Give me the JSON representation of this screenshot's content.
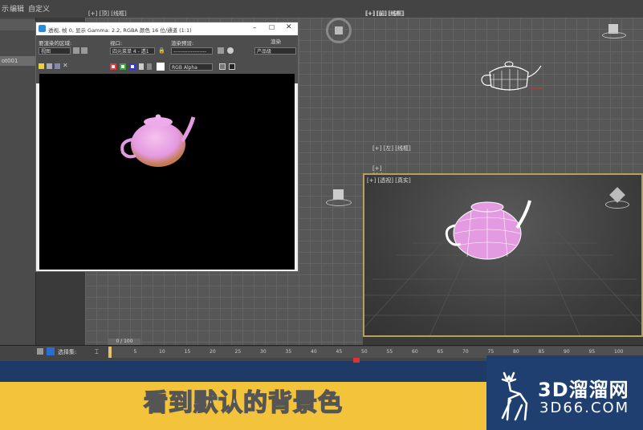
{
  "menu": {
    "item1": "示",
    "item2": "编辑",
    "item3": "自定义"
  },
  "left_panel": {
    "selected_item": "ot001"
  },
  "viewports": {
    "top_label": "[+] [顶] [线框]",
    "front_label": "[+] [前] [线框]",
    "left_label": "[+] [左] [线框]",
    "persp_label": "[+] [透视] [真实]"
  },
  "render_window": {
    "title": "透视, 帧 0, 显示 Gamma: 2.2, RGBA 颜色 16 位/通道 (1:1)",
    "area_label": "要渲染的区域:",
    "area_value": "视图",
    "viewport_label": "视口:",
    "viewport_value": "四元菜单 4 - 透1",
    "preset_label": "渲染预设:",
    "preset_value": "-------------------",
    "render_button": "渲染",
    "product_value": "产品级",
    "channel_value": "RGB Alpha"
  },
  "timeline": {
    "frame_counter": "0 / 100",
    "ticks": [
      "0",
      "5",
      "10",
      "15",
      "20",
      "25",
      "30",
      "35",
      "40",
      "45",
      "50",
      "55",
      "60",
      "65",
      "70",
      "75",
      "80",
      "85",
      "90",
      "95",
      "100"
    ],
    "select_label": "选择集:"
  },
  "subtitle": {
    "text": "看到默认的背景色"
  },
  "brand": {
    "name": "3D溜溜网",
    "domain": "3D66.COM"
  },
  "colors": {
    "accent_border": "#b8a05a",
    "teapot": "#e39ae0",
    "subtitle_band": "#f3c33c",
    "brand_bg": "#1f3f70"
  }
}
